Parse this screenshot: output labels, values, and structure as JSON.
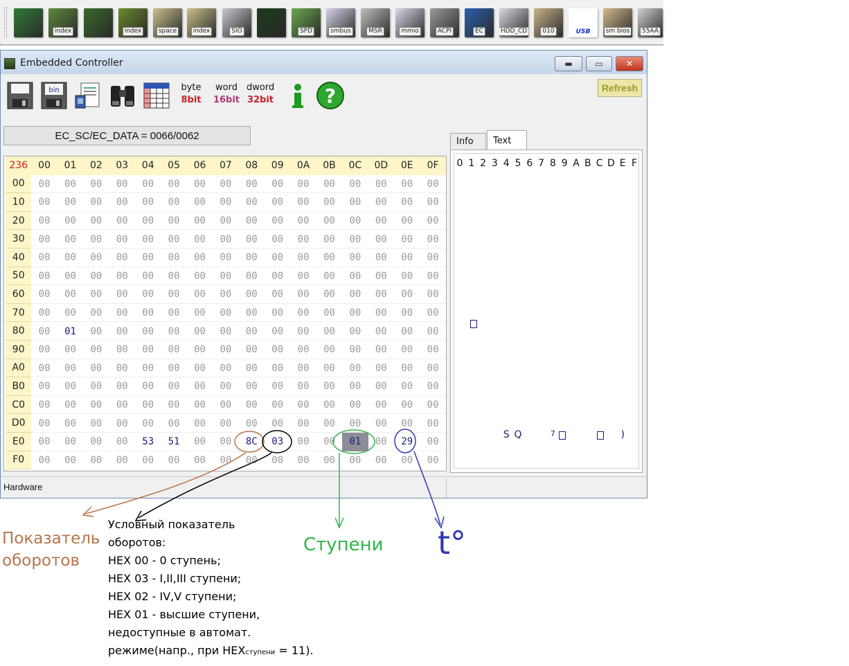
{
  "toolbar": {
    "buttons": [
      {
        "name": "pci-icon",
        "label": ""
      },
      {
        "name": "pci-index-icon",
        "label": "index"
      },
      {
        "name": "memory-icon",
        "label": ""
      },
      {
        "name": "memory-index-icon",
        "label": "index"
      },
      {
        "name": "io-space-icon",
        "label": "space"
      },
      {
        "name": "io-index-icon",
        "label": "index"
      },
      {
        "name": "sio-icon",
        "label": "SIO"
      },
      {
        "name": "oscilloscope-icon",
        "label": ""
      },
      {
        "name": "spd-icon",
        "label": "SPD"
      },
      {
        "name": "smbus-icon",
        "label": "smbus"
      },
      {
        "name": "msr-icon",
        "label": "MSR"
      },
      {
        "name": "mmio-icon",
        "label": "mmio"
      },
      {
        "name": "acpi-icon",
        "label": "ACPI"
      },
      {
        "name": "ec-icon",
        "label": "EC"
      },
      {
        "name": "hdd-cd-icon",
        "label": "HDD_CD"
      },
      {
        "name": "disk-icon",
        "label": "010"
      },
      {
        "name": "usb-icon",
        "label": "USB"
      },
      {
        "name": "smbios-icon",
        "label": "sm bios"
      },
      {
        "name": "55aa-icon",
        "label": "55AA"
      }
    ]
  },
  "window": {
    "title": "Embedded Controller",
    "minimize": "▬",
    "maximize": "▭",
    "close": "✕",
    "refresh_label": "Refresh",
    "port_field": "EC_SC/EC_DATA = 0066/0062",
    "width_buttons": [
      {
        "top": "byte",
        "bottom": "8bit",
        "color": "#c8202a"
      },
      {
        "top": "word",
        "bottom": "16bit",
        "color": "#b03a74"
      },
      {
        "top": "dword",
        "bottom": "32bit",
        "color": "#c8202a"
      }
    ],
    "status": "Hardware"
  },
  "grid": {
    "corner": "236",
    "col_headers": [
      "00",
      "01",
      "02",
      "03",
      "04",
      "05",
      "06",
      "07",
      "08",
      "09",
      "0A",
      "0B",
      "0C",
      "0D",
      "0E",
      "0F"
    ],
    "row_headers": [
      "00",
      "10",
      "20",
      "30",
      "40",
      "50",
      "60",
      "70",
      "80",
      "90",
      "A0",
      "B0",
      "C0",
      "D0",
      "E0",
      "F0"
    ],
    "default_value": "00",
    "nonzero": [
      {
        "row": 8,
        "col": 1,
        "value": "01"
      },
      {
        "row": 14,
        "col": 4,
        "value": "53"
      },
      {
        "row": 14,
        "col": 5,
        "value": "51"
      },
      {
        "row": 14,
        "col": 8,
        "value": "8C"
      },
      {
        "row": 14,
        "col": 9,
        "value": "03"
      },
      {
        "row": 14,
        "col": 12,
        "value": "01",
        "selected": true
      },
      {
        "row": 14,
        "col": 14,
        "value": "29"
      }
    ]
  },
  "text_panel": {
    "tabs": [
      "Info",
      "Text"
    ],
    "header_chars": [
      "0",
      "1",
      "2",
      "3",
      "4",
      "5",
      "6",
      "7",
      "8",
      "9",
      "A",
      "B",
      "C",
      "D",
      "E",
      "F"
    ],
    "e0_text": {
      "s": "S",
      "q": "Q",
      "seven": "7",
      "paren": ")"
    }
  },
  "annotations": {
    "rpm_title_line1": "Показатель",
    "rpm_title_line2": "оборотов",
    "note_lines": [
      "Условный показатель",
      "оборотов:",
      "HEX 00 - 0 ступень;",
      "HEX 03 - I,II,III ступени;",
      "HEX 02 - IV,V ступени;",
      "HEX 01 - высшие ступени,",
      "недоступные в автомат.",
      "режиме(напр., при HEX",
      "ступени",
      " = 11)."
    ],
    "stages_label": "Ступени",
    "temp_label": "t°",
    "colors": {
      "rpm": "#b8744a",
      "note": "#000000",
      "stages": "#2fb34a",
      "temp": "#3037b5"
    }
  }
}
